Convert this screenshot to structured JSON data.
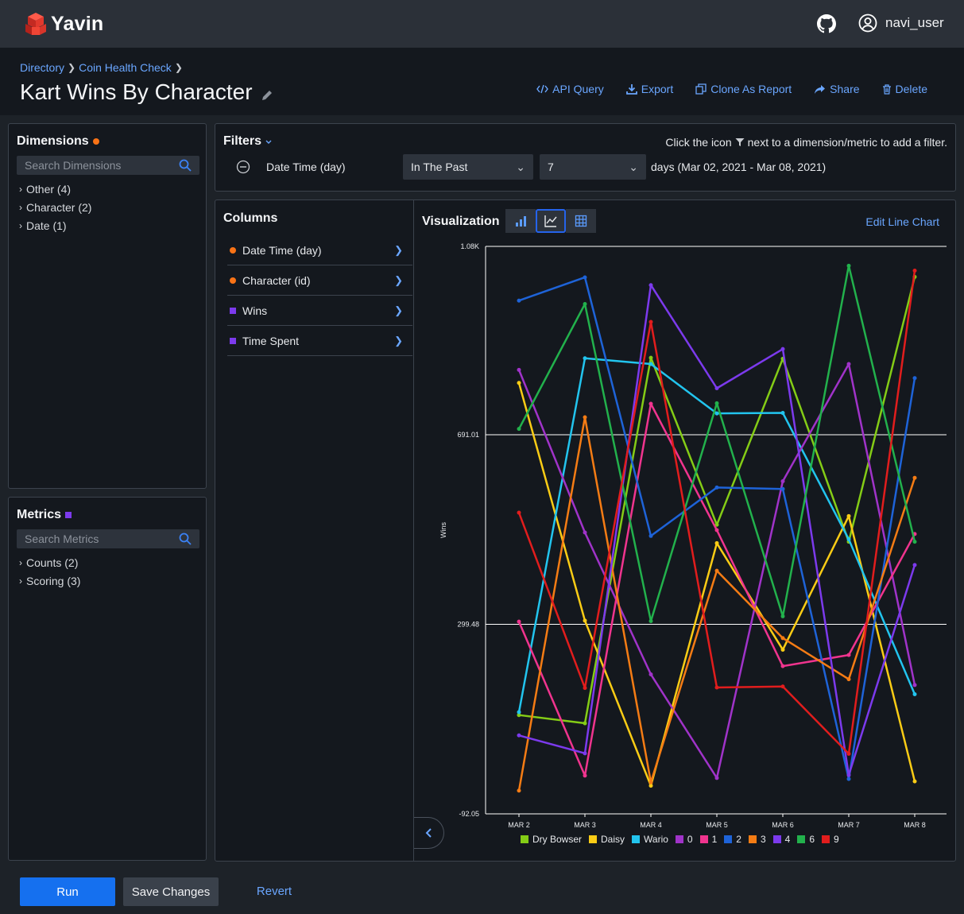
{
  "app": {
    "name": "Yavin",
    "user": "navi_user"
  },
  "breadcrumb": [
    "Directory",
    "Coin Health Check"
  ],
  "report": {
    "title": "Kart Wins By Character"
  },
  "actions": [
    {
      "label": "API Query",
      "icon": "code-icon"
    },
    {
      "label": "Export",
      "icon": "download-icon"
    },
    {
      "label": "Clone As Report",
      "icon": "clone-icon"
    },
    {
      "label": "Share",
      "icon": "share-icon"
    },
    {
      "label": "Delete",
      "icon": "trash-icon"
    }
  ],
  "dimensions": {
    "title": "Dimensions",
    "search_placeholder": "Search Dimensions",
    "items": [
      "Other (4)",
      "Character (2)",
      "Date (1)"
    ]
  },
  "metrics": {
    "title": "Metrics",
    "search_placeholder": "Search Metrics",
    "items": [
      "Counts (2)",
      "Scoring (3)"
    ]
  },
  "filters": {
    "title": "Filters",
    "hint_before": "Click the icon",
    "hint_after": "next to a dimension/metric to add a filter.",
    "row": {
      "field": "Date Time (day)",
      "operator": "In The Past",
      "value": "7",
      "suffix": "days (Mar 02, 2021 - Mar 08, 2021)"
    }
  },
  "columns": {
    "title": "Columns",
    "items": [
      {
        "label": "Date Time (day)",
        "kind": "dimension"
      },
      {
        "label": "Character (id)",
        "kind": "dimension"
      },
      {
        "label": "Wins",
        "kind": "metric"
      },
      {
        "label": "Time Spent",
        "kind": "metric"
      }
    ]
  },
  "visualization": {
    "title": "Visualization",
    "edit_label": "Edit Line Chart",
    "active_type": "line"
  },
  "footer": {
    "run": "Run",
    "save": "Save Changes",
    "revert": "Revert"
  },
  "colors": {
    "accent": "#1570ef",
    "link": "#6aa6ff",
    "dimension": "#f97316",
    "metric": "#7c3aed"
  },
  "chart_data": {
    "type": "line",
    "title": "",
    "xlabel": "",
    "ylabel": "Wins",
    "x": [
      "MAR 2",
      "MAR 3",
      "MAR 4",
      "MAR 5",
      "MAR 6",
      "MAR 7",
      "MAR 8"
    ],
    "ylim": [
      -92.05,
      1080
    ],
    "yticks": [
      "1.08K",
      "691.01",
      "299.48",
      "-92.05"
    ],
    "legend_position": "bottom",
    "series": [
      {
        "name": "Dry Bowser",
        "color": "#84cc16",
        "values": [
          112,
          95,
          850,
          505,
          848,
          470,
          1017
        ]
      },
      {
        "name": "Daisy",
        "color": "#facc15",
        "values": [
          798,
          307,
          -34,
          467,
          247,
          523,
          -25
        ]
      },
      {
        "name": "Wario",
        "color": "#22c4ee",
        "values": [
          118,
          849,
          837,
          735,
          736,
          475,
          155
        ]
      },
      {
        "name": "0",
        "color": "#a033c9",
        "values": [
          825,
          489,
          196,
          -18,
          595,
          837,
          174
        ]
      },
      {
        "name": "1",
        "color": "#f0348e",
        "values": [
          305,
          -13,
          755,
          494,
          213,
          236,
          486
        ]
      },
      {
        "name": "2",
        "color": "#1e63d8",
        "values": [
          968,
          1016,
          482,
          582,
          579,
          -20,
          808
        ]
      },
      {
        "name": "3",
        "color": "#f57c14",
        "values": [
          -44,
          727,
          -27,
          410,
          271,
          186,
          602
        ]
      },
      {
        "name": "4",
        "color": "#7c3aed",
        "values": [
          70,
          33,
          1000,
          787,
          868,
          -12,
          422
        ]
      },
      {
        "name": "6",
        "color": "#22b14c",
        "values": [
          703,
          961,
          306,
          756,
          316,
          1040,
          470
        ]
      },
      {
        "name": "9",
        "color": "#e11d1d",
        "values": [
          530,
          168,
          924,
          169,
          171,
          32,
          1030
        ]
      }
    ]
  }
}
